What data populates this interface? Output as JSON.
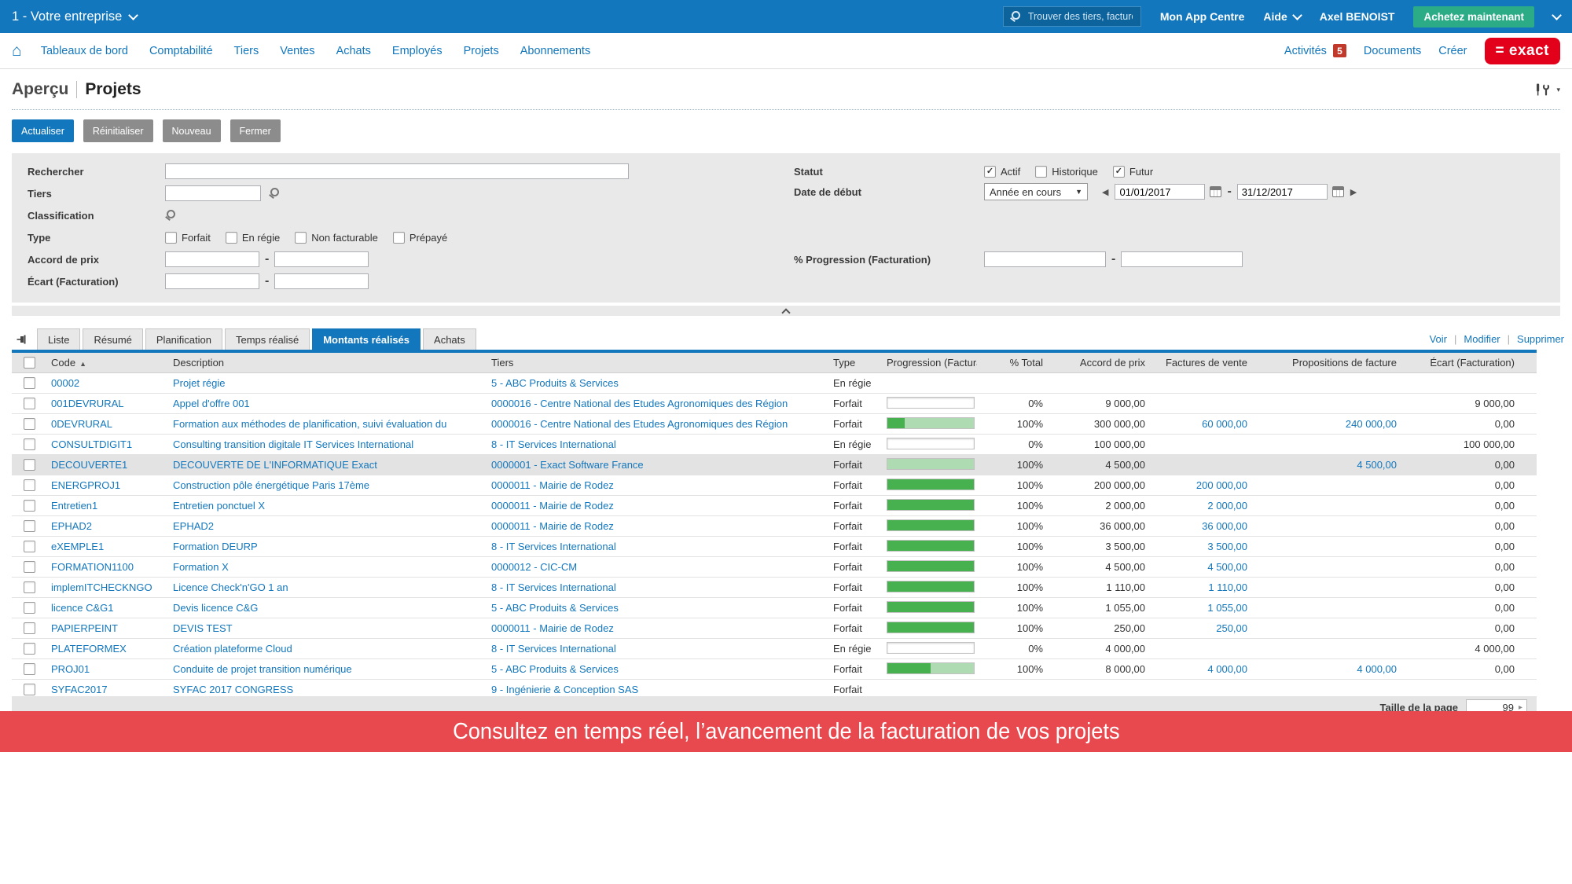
{
  "topbar": {
    "company": "1 - Votre entreprise",
    "search_placeholder": "Trouver des tiers, factures, écr...",
    "app_centre": "Mon App Centre",
    "help": "Aide",
    "user": "Axel BENOIST",
    "buy_now": "Achetez maintenant"
  },
  "navbar": {
    "items": [
      "Tableaux de bord",
      "Comptabilité",
      "Tiers",
      "Ventes",
      "Achats",
      "Employés",
      "Projets",
      "Abonnements"
    ],
    "activities": "Activités",
    "activities_count": "5",
    "documents": "Documents",
    "create": "Créer",
    "logo": "= exact"
  },
  "page": {
    "breadcrumb": "Aperçu",
    "title": "Projets"
  },
  "toolbar": {
    "refresh": "Actualiser",
    "reset": "Réinitialiser",
    "new": "Nouveau",
    "close": "Fermer"
  },
  "filters": {
    "search_label": "Rechercher",
    "tiers_label": "Tiers",
    "classification_label": "Classification",
    "type_label": "Type",
    "type_options": [
      "Forfait",
      "En régie",
      "Non facturable",
      "Prépayé"
    ],
    "price_agreement_label": "Accord de prix",
    "variance_label": "Écart (Facturation)",
    "status_label": "Statut",
    "status_options": [
      {
        "label": "Actif",
        "checked": true
      },
      {
        "label": "Historique",
        "checked": false
      },
      {
        "label": "Futur",
        "checked": true
      }
    ],
    "start_date_label": "Date de début",
    "start_date_preset": "Année en cours",
    "date_from": "01/01/2017",
    "date_to": "31/12/2017",
    "progression_label": "% Progression (Facturation)"
  },
  "tabs": {
    "items": [
      "Liste",
      "Résumé",
      "Planification",
      "Temps réalisé",
      "Montants réalisés",
      "Achats"
    ],
    "active": "Montants réalisés",
    "actions": [
      "Voir",
      "Modifier",
      "Supprimer"
    ]
  },
  "table": {
    "columns": [
      "Code",
      "Description",
      "Tiers",
      "Type",
      "Progression (Facturation)",
      "% Total",
      "Accord de prix",
      "Factures de vente",
      "Propositions de facture",
      "Écart (Facturation)"
    ],
    "rows": [
      {
        "code": "00002",
        "description": "Projet régie",
        "tiers": "5 - ABC Produits & Services",
        "type": "En régie",
        "bar": null,
        "pct": "",
        "accord": "",
        "factures": "",
        "propositions": "",
        "ecart": "",
        "selected": false
      },
      {
        "code": "001DEVRURAL",
        "description": "Appel d'offre 001",
        "tiers": "0000016 - Centre National des Etudes Agronomiques des Région",
        "type": "Forfait",
        "bar": {
          "dark": 0,
          "light": 0
        },
        "pct": "0%",
        "accord": "9 000,00",
        "factures": "",
        "propositions": "",
        "ecart": "9 000,00",
        "selected": false
      },
      {
        "code": "0DEVRURAL",
        "description": "Formation aux méthodes de planification, suivi évaluation du",
        "tiers": "0000016 - Centre National des Etudes Agronomiques des Région",
        "type": "Forfait",
        "bar": {
          "dark": 20,
          "light": 80
        },
        "pct": "100%",
        "accord": "300 000,00",
        "factures": "60 000,00",
        "propositions": "240 000,00",
        "ecart": "0,00",
        "selected": false
      },
      {
        "code": "CONSULTDIGIT1",
        "description": "Consulting transition digitale IT Services International",
        "tiers": "8 - IT Services International",
        "type": "En régie",
        "bar": {
          "dark": 0,
          "light": 0
        },
        "pct": "0%",
        "accord": "100 000,00",
        "factures": "",
        "propositions": "",
        "ecart": "100 000,00",
        "selected": false
      },
      {
        "code": "DECOUVERTE1",
        "description": "DECOUVERTE DE L'INFORMATIQUE Exact",
        "tiers": "0000001 - Exact Software France",
        "type": "Forfait",
        "bar": {
          "dark": 0,
          "light": 100
        },
        "pct": "100%",
        "accord": "4 500,00",
        "factures": "",
        "propositions": "4 500,00",
        "ecart": "0,00",
        "selected": true
      },
      {
        "code": "ENERGPROJ1",
        "description": "Construction pôle énergétique Paris 17ème",
        "tiers": "0000011 - Mairie de Rodez",
        "type": "Forfait",
        "bar": {
          "dark": 100,
          "light": 0
        },
        "pct": "100%",
        "accord": "200 000,00",
        "factures": "200 000,00",
        "propositions": "",
        "ecart": "0,00",
        "selected": false
      },
      {
        "code": "Entretien1",
        "description": "Entretien ponctuel X",
        "tiers": "0000011 - Mairie de Rodez",
        "type": "Forfait",
        "bar": {
          "dark": 100,
          "light": 0
        },
        "pct": "100%",
        "accord": "2 000,00",
        "factures": "2 000,00",
        "propositions": "",
        "ecart": "0,00",
        "selected": false
      },
      {
        "code": "EPHAD2",
        "description": "EPHAD2",
        "tiers": "0000011 - Mairie de Rodez",
        "type": "Forfait",
        "bar": {
          "dark": 100,
          "light": 0
        },
        "pct": "100%",
        "accord": "36 000,00",
        "factures": "36 000,00",
        "propositions": "",
        "ecart": "0,00",
        "selected": false
      },
      {
        "code": "eXEMPLE1",
        "description": "Formation DEURP",
        "tiers": "8 - IT Services International",
        "type": "Forfait",
        "bar": {
          "dark": 100,
          "light": 0
        },
        "pct": "100%",
        "accord": "3 500,00",
        "factures": "3 500,00",
        "propositions": "",
        "ecart": "0,00",
        "selected": false
      },
      {
        "code": "FORMATION1100",
        "description": "Formation X",
        "tiers": "0000012 - CIC-CM",
        "type": "Forfait",
        "bar": {
          "dark": 100,
          "light": 0
        },
        "pct": "100%",
        "accord": "4 500,00",
        "factures": "4 500,00",
        "propositions": "",
        "ecart": "0,00",
        "selected": false
      },
      {
        "code": "implemITCHECKNGO",
        "description": "Licence Check'n'GO 1 an",
        "tiers": "8 - IT Services International",
        "type": "Forfait",
        "bar": {
          "dark": 100,
          "light": 0
        },
        "pct": "100%",
        "accord": "1 110,00",
        "factures": "1 110,00",
        "propositions": "",
        "ecart": "0,00",
        "selected": false
      },
      {
        "code": "licence C&G1",
        "description": "Devis licence C&G",
        "tiers": "5 - ABC Produits & Services",
        "type": "Forfait",
        "bar": {
          "dark": 100,
          "light": 0
        },
        "pct": "100%",
        "accord": "1 055,00",
        "factures": "1 055,00",
        "propositions": "",
        "ecart": "0,00",
        "selected": false
      },
      {
        "code": "PAPIERPEINT",
        "description": "DEVIS TEST",
        "tiers": "0000011 - Mairie de Rodez",
        "type": "Forfait",
        "bar": {
          "dark": 100,
          "light": 0
        },
        "pct": "100%",
        "accord": "250,00",
        "factures": "250,00",
        "propositions": "",
        "ecart": "0,00",
        "selected": false
      },
      {
        "code": "PLATEFORMEX",
        "description": "Création plateforme Cloud",
        "tiers": "8 - IT Services International",
        "type": "En régie",
        "bar": {
          "dark": 0,
          "light": 0
        },
        "pct": "0%",
        "accord": "4 000,00",
        "factures": "",
        "propositions": "",
        "ecart": "4 000,00",
        "selected": false
      },
      {
        "code": "PROJ01",
        "description": "Conduite de projet transition numérique",
        "tiers": "5 - ABC Produits & Services",
        "type": "Forfait",
        "bar": {
          "dark": 50,
          "light": 50
        },
        "pct": "100%",
        "accord": "8 000,00",
        "factures": "4 000,00",
        "propositions": "4 000,00",
        "ecart": "0,00",
        "selected": false
      },
      {
        "code": "SYFAC2017",
        "description": "SYFAC 2017 CONGRESS",
        "tiers": "9 - Ingénierie & Conception SAS",
        "type": "Forfait",
        "bar": null,
        "pct": "",
        "accord": "",
        "factures": "",
        "propositions": "",
        "ecart": "",
        "selected": false
      }
    ]
  },
  "footer": {
    "page_size_label": "Taille de la page",
    "page_size": "99"
  },
  "banner": {
    "text": "Consultez en temps réel, l’avancement de la facturation de vos projets"
  },
  "colors": {
    "accent": "#1377bd",
    "topbar_search_bg": "#0d639c",
    "buy_green": "#2cab87",
    "logo_red": "#e2001a",
    "badge_red": "#c0392b",
    "banner_red": "#e8494f",
    "bar_dark": "#47b04f",
    "bar_light": "#aedbb2",
    "panel_gray": "#e9e9e9",
    "tab_inactive": "#e8e8e8",
    "row_selected": "#e3e3e3"
  }
}
